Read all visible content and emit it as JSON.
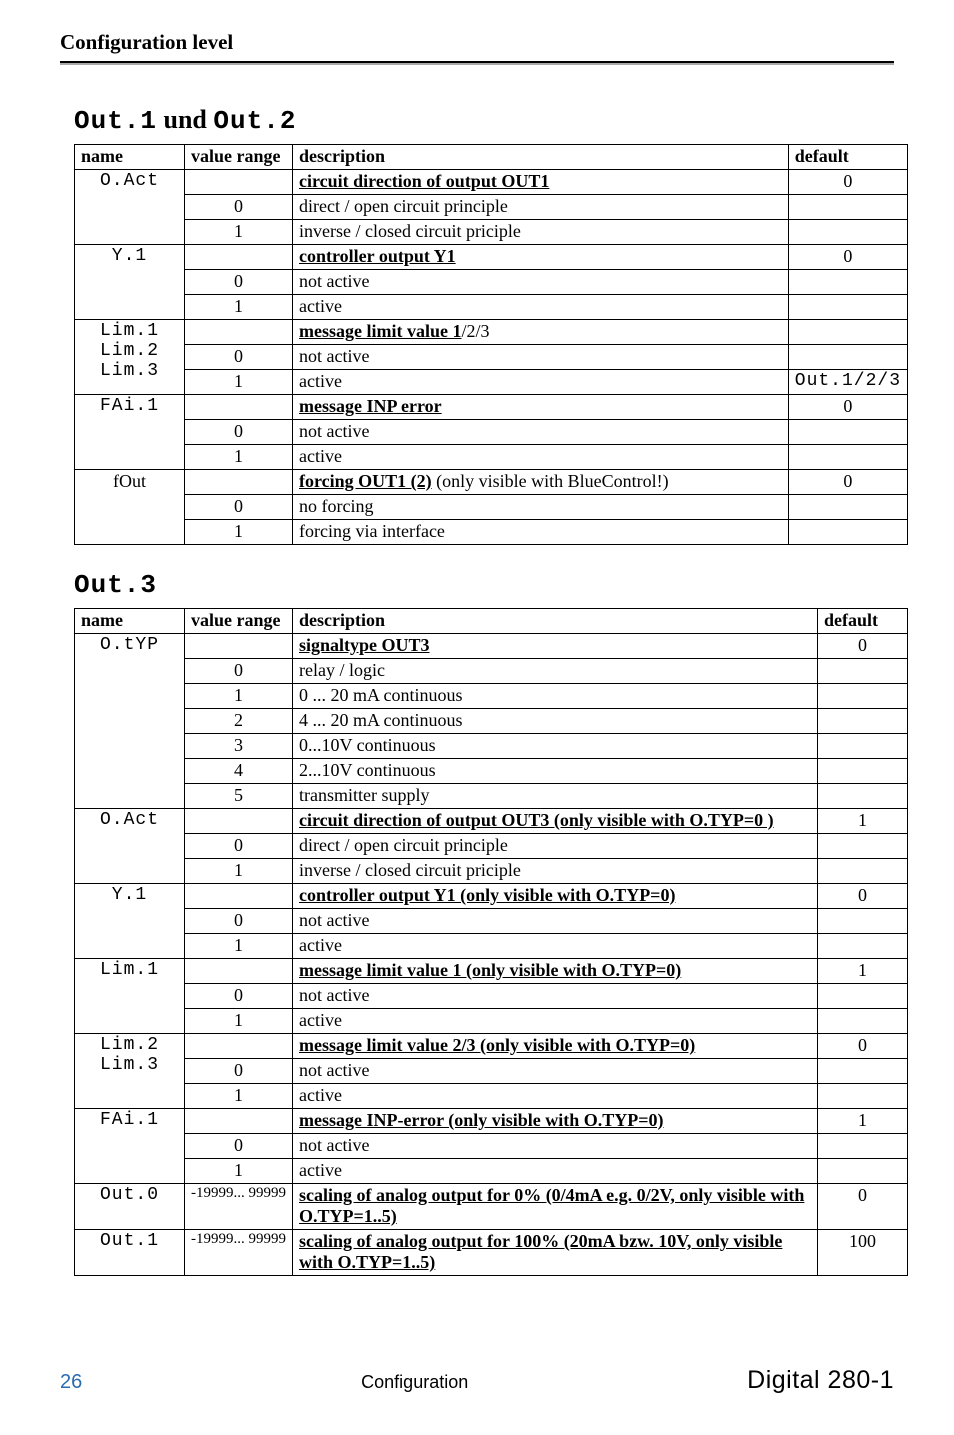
{
  "header": {
    "title": "Configuration level"
  },
  "section1": {
    "title_pre": "Out.1",
    "title_mid": " und ",
    "title_post": "Out.2",
    "columns": {
      "name": "name",
      "range": "value range",
      "desc": "description",
      "def": "default"
    },
    "rows": [
      {
        "name": "O.Act",
        "range": "",
        "desc_b": "circuit direction of output  OUT1",
        "def": "0",
        "bold": true
      },
      {
        "name": "",
        "range": "0",
        "desc": "direct / open circuit principle",
        "def": ""
      },
      {
        "name": "",
        "range": "1",
        "desc": "inverse / closed circuit priciple",
        "def": ""
      },
      {
        "name": "Y.1",
        "range": "",
        "desc_b": "controller output Y1",
        "def": "0",
        "bold": true
      },
      {
        "name": "",
        "range": "0",
        "desc": "not active",
        "def": ""
      },
      {
        "name": "",
        "range": "1",
        "desc": "active",
        "def": ""
      },
      {
        "name": "Lim.1\nLim.2\nLim.3",
        "range": "",
        "desc_b": "message limit value  1",
        "desc_tail": "/2/3",
        "def": "",
        "bold": true
      },
      {
        "name": "",
        "range": "0",
        "desc": "not active",
        "def": ""
      },
      {
        "name": "",
        "range": "1",
        "desc": "active",
        "def": "Out.1/2/3"
      },
      {
        "name": "FAi.1",
        "range": "",
        "desc_b": "message INP error",
        "def": "0",
        "bold": true
      },
      {
        "name": "",
        "range": "0",
        "desc": "not active",
        "def": ""
      },
      {
        "name": "",
        "range": "1",
        "desc": "active",
        "def": ""
      },
      {
        "name": "fOut",
        "range": "",
        "desc_b": "forcing OUT1 (2)",
        "desc_tail": "  (only visible with BlueControl!)",
        "def": "0",
        "bold": true,
        "name_plain": true
      },
      {
        "name": "",
        "range": "0",
        "desc": "no forcing",
        "def": ""
      },
      {
        "name": "",
        "range": "1",
        "desc": "forcing via interface",
        "def": ""
      }
    ]
  },
  "section2": {
    "title": "Out.3",
    "columns": {
      "name": "name",
      "range": "value range",
      "desc": "description",
      "def": "default"
    },
    "rows": [
      {
        "name": "O.tYP",
        "range": "",
        "desc_b": "signaltype OUT3",
        "def": "0",
        "bold": true
      },
      {
        "name": "",
        "range": "0",
        "desc": "relay /  logic",
        "def": ""
      },
      {
        "name": "",
        "range": "1",
        "desc": "0 ... 20 mA continuous",
        "def": ""
      },
      {
        "name": "",
        "range": "2",
        "desc": "4 ... 20 mA continuous",
        "def": ""
      },
      {
        "name": "",
        "range": "3",
        "desc": "0...10V continuous",
        "def": ""
      },
      {
        "name": "",
        "range": "4",
        "desc": "2...10V continuous",
        "def": ""
      },
      {
        "name": "",
        "range": "5",
        "desc": "transmitter supply",
        "def": ""
      },
      {
        "name": "O.Act",
        "range": "",
        "desc_b": "circuit direction of output OUT3 (only visible with O.TYP=0 )",
        "def": "1",
        "bold": true
      },
      {
        "name": "",
        "range": "0",
        "desc": "direct / open circuit principle",
        "def": ""
      },
      {
        "name": "",
        "range": "1",
        "desc": "inverse / closed circuit priciple",
        "def": ""
      },
      {
        "name": "Y.1",
        "range": "",
        "desc_b": "controller output Y1  (only visible with O.TYP=0)",
        "def": "0",
        "bold": true
      },
      {
        "name": "",
        "range": "0",
        "desc": "not active",
        "def": ""
      },
      {
        "name": "",
        "range": "1",
        "desc": "active",
        "def": ""
      },
      {
        "name": "Lim.1",
        "range": "",
        "desc_b": "message limit value 1  (only visible with O.TYP=0)",
        "def": "1",
        "bold": true
      },
      {
        "name": "",
        "range": "0",
        "desc": "not active",
        "def": ""
      },
      {
        "name": "",
        "range": "1",
        "desc": "active",
        "def": ""
      },
      {
        "name": "Lim.2\nLim.3",
        "range": "",
        "desc_b": "message limit value  2/3  (only visible with O.TYP=0)",
        "def": "0",
        "bold": true
      },
      {
        "name": "",
        "range": "0",
        "desc": "not active",
        "def": ""
      },
      {
        "name": "",
        "range": "1",
        "desc": "active",
        "def": ""
      },
      {
        "name": "FAi.1",
        "range": "",
        "desc_b": "message INP-error (only visible with O.TYP=0)",
        "def": "1",
        "bold": true
      },
      {
        "name": "",
        "range": "0",
        "desc": "not active",
        "def": ""
      },
      {
        "name": "",
        "range": "1",
        "desc": "active",
        "def": ""
      },
      {
        "name": "Out.0",
        "range": "-19999... 99999",
        "desc_b": "scaling of analog output for 0% (0/4mA e.g. 0/2V, only visible with  O.TYP=1..5)",
        "def": "0",
        "bold": true,
        "small_range": true
      },
      {
        "name": "Out.1",
        "range": "-19999... 99999",
        "desc_b": "scaling of analog output for 100% (20mA bzw. 10V, only visible with O.TYP=1..5)",
        "def": "100",
        "bold": true,
        "small_range": true
      }
    ]
  },
  "footer": {
    "page": "26",
    "mid": "Configuration",
    "model": "Digital 280-1"
  }
}
